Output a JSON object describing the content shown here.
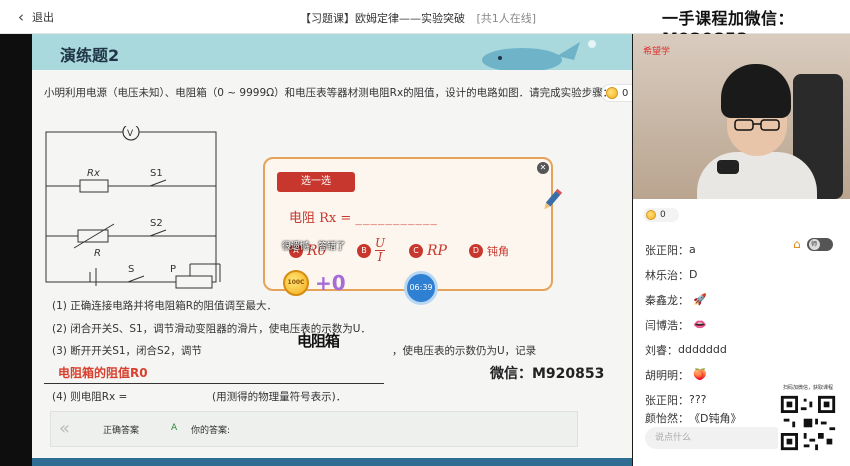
{
  "topbar": {
    "back_label": "退出",
    "title": "【习题课】欧姆定律——实验突破",
    "online": "[共1人在线]",
    "watermark": "一手课程加微信：M920853"
  },
  "slide": {
    "exercise_title": "演练题2",
    "question": "小明利用电源（电压未知）、电阻箱（0 ~ 9999Ω）和电压表等器材测电阻Rx的阻值，设计的电路如图．请完成实验步骤：",
    "circuit_labels": {
      "voltmeter": "V",
      "rx": "Rx",
      "s1": "S1",
      "s2": "S2",
      "r": "R",
      "s": "S",
      "p": "P"
    },
    "step1": "(1) 正确连接电路并将电阻箱R的阻值调至最大．",
    "step2": "(2) 闭合开关S、S1，调节滑动变阻器的滑片，使电压表的示数为U．",
    "step3_left": "(3) 断开开关S1，闭合S2，调节",
    "step3_right": "，使电压表的示数仍为U，记录",
    "handwriting1": "电阻箱",
    "handwriting2": "电阻箱的阻值R0",
    "watermark_slide": "微信：M920853",
    "step4_left": "(4) 则电阻Rx =",
    "step4_right": "(用测得的物理量符号表示)．",
    "answer_label": "正确答案",
    "answer_value": "A",
    "your_answer_label": "你的答案:",
    "coin_count": "0"
  },
  "popup": {
    "tag": "选一选",
    "formula_left": "电阻 Rx =",
    "formula_blank": "___________",
    "options": [
      {
        "letter": "A",
        "text": "R0"
      },
      {
        "letter": "B",
        "num": "U",
        "den": "I"
      },
      {
        "letter": "C",
        "text": "RP"
      },
      {
        "letter": "D",
        "text": "钝角"
      }
    ]
  },
  "overlay": {
    "toast": "很遗憾，答错了",
    "coin_label": "100C",
    "plus": "+0",
    "timer": "06:39"
  },
  "right": {
    "cam_logo": "希望学",
    "coin_count": "0",
    "chat": [
      {
        "name": "张正阳",
        "text": "a"
      },
      {
        "name": "林乐治",
        "text": "D"
      },
      {
        "name": "秦鑫龙",
        "text": "",
        "sym": "🚀"
      },
      {
        "name": "闫博浩",
        "text": "",
        "sym": "👄"
      },
      {
        "name": "刘睿",
        "text": "ddddddd"
      },
      {
        "name": "胡明明",
        "text": "",
        "sym": "🍑"
      },
      {
        "name": "张正阳",
        "text": "???"
      },
      {
        "name": "颜怡然",
        "text": "《D钝角》"
      }
    ],
    "teacher_toggle": "师",
    "input_placeholder": "说点什么",
    "qr_caption": "扫码加微信，获取课程"
  },
  "colors": {
    "accent_red": "#c8372d",
    "popup_border": "#e4a25b",
    "header_band": "#a9d8dd"
  }
}
